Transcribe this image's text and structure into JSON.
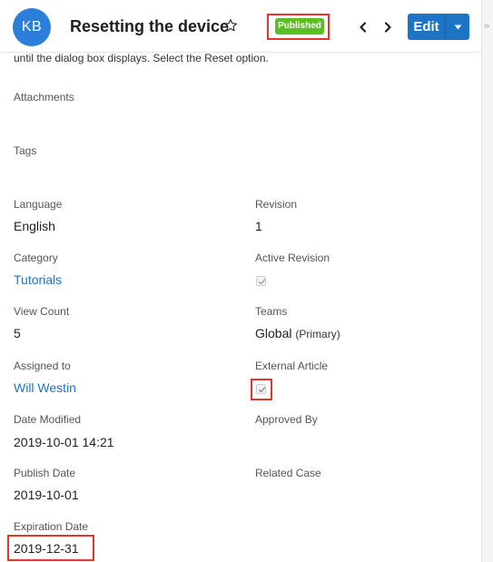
{
  "header": {
    "avatar_initials": "KB",
    "title": "Resetting the device",
    "status_badge": "Published",
    "edit_label": "Edit"
  },
  "body": {
    "truncated_text": "until the dialog box displays. Select the Reset option.",
    "attachments_label": "Attachments",
    "tags_label": "Tags"
  },
  "fields": {
    "language": {
      "label": "Language",
      "value": "English"
    },
    "revision": {
      "label": "Revision",
      "value": "1"
    },
    "category": {
      "label": "Category",
      "value": "Tutorials"
    },
    "active_revision": {
      "label": "Active Revision",
      "checked": true
    },
    "view_count": {
      "label": "View Count",
      "value": "5"
    },
    "teams": {
      "label": "Teams",
      "value": "Global",
      "tag": "(Primary)"
    },
    "assigned_to": {
      "label": "Assigned to",
      "value": "Will Westin"
    },
    "external_article": {
      "label": "External Article",
      "checked": true
    },
    "date_modified": {
      "label": "Date Modified",
      "value": "2019-10-01 14:21"
    },
    "approved_by": {
      "label": "Approved By",
      "value": ""
    },
    "publish_date": {
      "label": "Publish Date",
      "value": "2019-10-01"
    },
    "related_case": {
      "label": "Related Case",
      "value": ""
    },
    "expiration_date": {
      "label": "Expiration Date",
      "value": "2019-12-31"
    }
  },
  "colors": {
    "accent": "#1c74c7",
    "published": "#5cbf1f",
    "highlight": "#e8352b",
    "avatar": "#2c7fd8"
  }
}
